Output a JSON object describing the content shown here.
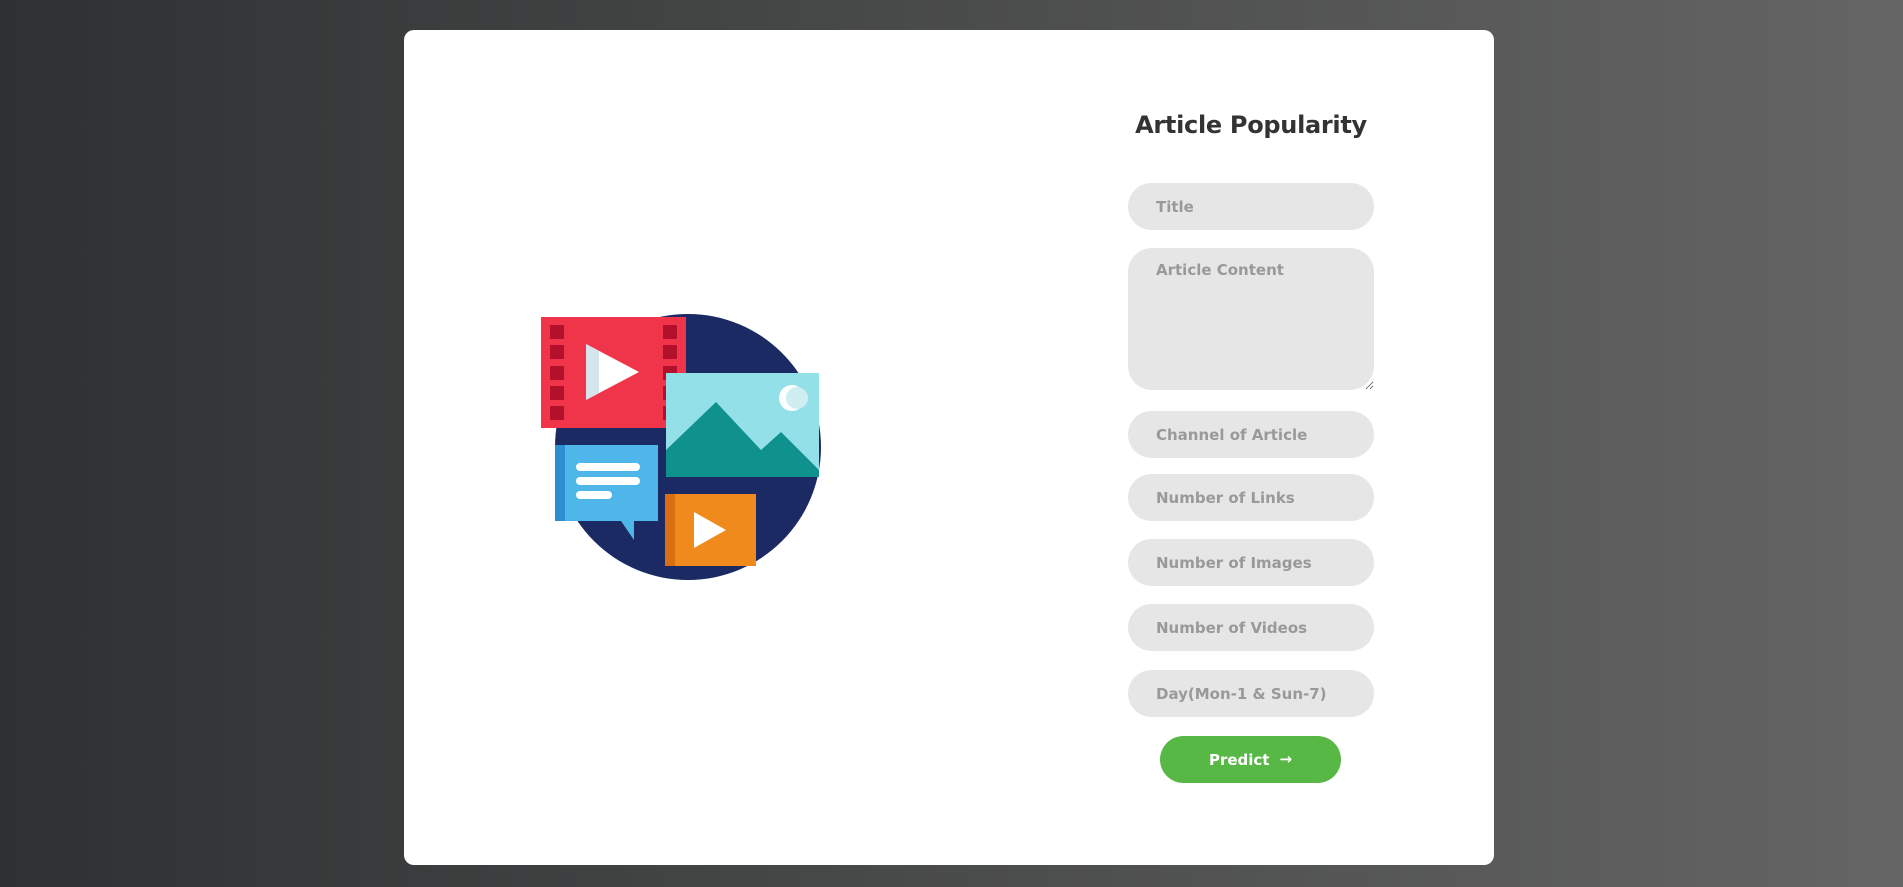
{
  "form": {
    "title": "Article Popularity",
    "fields": {
      "title": {
        "placeholder": "Title",
        "value": ""
      },
      "content": {
        "placeholder": "Article Content",
        "value": ""
      },
      "channel": {
        "placeholder": "Channel of Article",
        "value": ""
      },
      "links": {
        "placeholder": "Number of Links",
        "value": ""
      },
      "images": {
        "placeholder": "Number of Images",
        "value": ""
      },
      "videos": {
        "placeholder": "Number of Videos",
        "value": ""
      },
      "day": {
        "placeholder": "Day(Mon-1 & Sun-7)",
        "value": ""
      }
    },
    "submit_label": "Predict",
    "submit_icon": "→"
  },
  "colors": {
    "accent": "#57b846",
    "field_bg": "#e6e6e6",
    "title_text": "#333333"
  },
  "illustration": {
    "icon": "multimedia-illustration"
  }
}
